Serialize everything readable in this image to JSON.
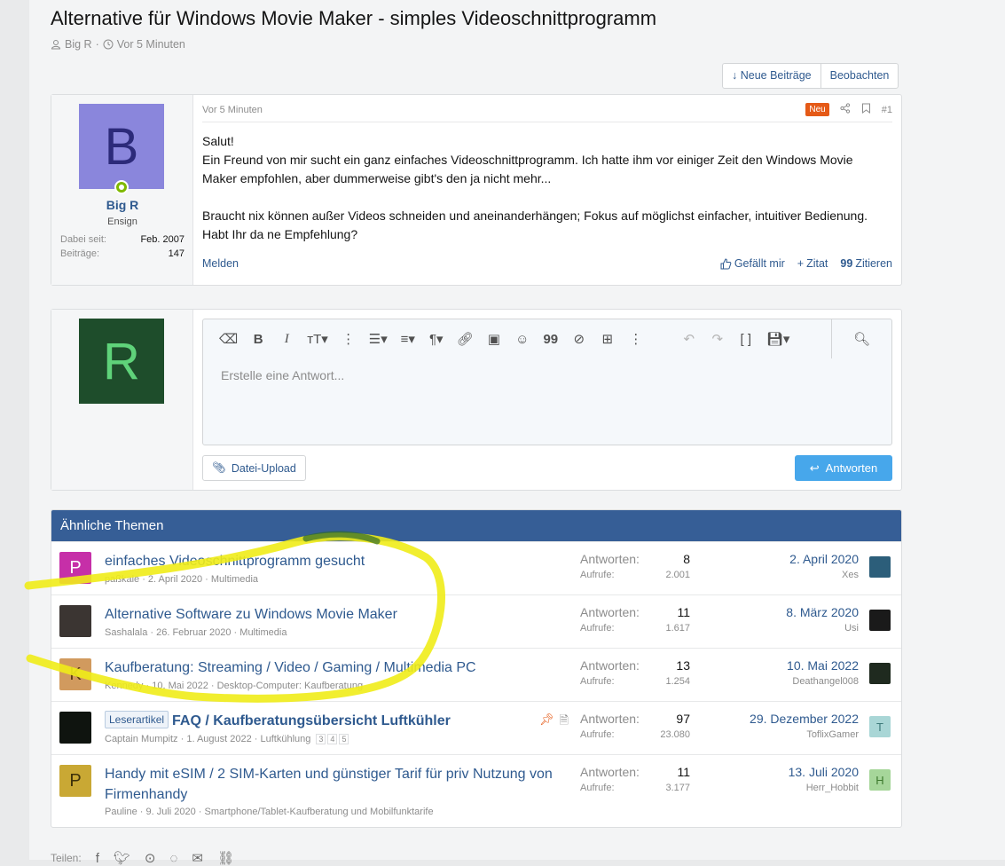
{
  "thread": {
    "title": "Alternative für Windows Movie Maker - simples Videoschnittprogramm",
    "author": "Big R",
    "time": "Vor 5 Minuten",
    "actions": [
      "↓ Neue Beiträge",
      "Beobachten"
    ]
  },
  "post": {
    "avatar_letter": "B",
    "avatar_bg": "#8a86dc",
    "avatar_fg": "#2c2a7a",
    "username": "Big R",
    "user_title": "Ensign",
    "stats": [
      {
        "label": "Dabei seit:",
        "value": "Feb. 2007"
      },
      {
        "label": "Beiträge:",
        "value": "147"
      }
    ],
    "time": "Vor 5 Minuten",
    "badge": "Neu",
    "number": "#1",
    "paragraphs": [
      "Salut!\nEin Freund von mir sucht ein ganz einfaches Videoschnittprogramm. Ich hatte ihm vor einiger Zeit den Windows Movie Maker empfohlen, aber dummerweise gibt's den ja nicht mehr...",
      "Braucht nix können außer Videos schneiden und aneinanderhängen; Fokus auf möglichst einfacher, intuitiver Bedienung. Habt Ihr da ne Empfehlung?"
    ],
    "report": "Melden",
    "like": "Gefällt mir",
    "quote_add": "Zitat",
    "quote": "Zitieren"
  },
  "reply": {
    "avatar_letter": "R",
    "avatar_bg": "#1e4d2b",
    "avatar_fg": "#5fd37a",
    "placeholder": "Erstelle eine Antwort...",
    "upload": "Datei-Upload",
    "submit": "Antworten"
  },
  "similar": {
    "heading": "Ähnliche Themen",
    "threads": [
      {
        "title": "einfaches Videoschnittprogramm gesucht",
        "author": "paßkale",
        "date": "2. April 2020",
        "forum": "Multimedia",
        "avatar": "P",
        "avatar_bg": "#c62fa8",
        "avatar_fg": "#ffffff",
        "replies_label": "Antworten:",
        "replies": "8",
        "views_label": "Aufrufe:",
        "views": "2.001",
        "last_date": "2. April 2020",
        "last_user": "Xes",
        "last_avatar": "",
        "last_bg": "#2c5e7a"
      },
      {
        "title": "Alternative Software zu Windows Movie Maker",
        "author": "Sashalala",
        "date": "26. Februar 2020",
        "forum": "Multimedia",
        "avatar": "",
        "avatar_bg": "#3b3532",
        "avatar_fg": "#ffffff",
        "replies_label": "Antworten:",
        "replies": "11",
        "views_label": "Aufrufe:",
        "views": "1.617",
        "last_date": "8. März 2020",
        "last_user": "Usi",
        "last_avatar": "",
        "last_bg": "#1a1a1a"
      },
      {
        "title": "Kaufberatung: Streaming / Video / Gaming / Multimedia PC",
        "author": "Kennedy",
        "date": "10. Mai 2022",
        "forum": "Desktop-Computer: Kaufberatung",
        "avatar": "K",
        "avatar_bg": "#d19a5e",
        "avatar_fg": "#5a3a14",
        "replies_label": "Antworten:",
        "replies": "13",
        "views_label": "Aufrufe:",
        "views": "1.254",
        "last_date": "10. Mai 2022",
        "last_user": "Deathangel008",
        "last_avatar": "",
        "last_bg": "#1f2a1f"
      },
      {
        "tag": "Leserartikel",
        "title": "FAQ / Kaufberatungsübersicht Luftkühler",
        "author": "Captain Mumpitz",
        "date": "1. August 2022",
        "forum": "Luftkühlung",
        "pages": [
          "3",
          "4",
          "5"
        ],
        "avatar": "",
        "avatar_bg": "#0f140f",
        "avatar_fg": "#5ecf5e",
        "replies_label": "Antworten:",
        "replies": "97",
        "views_label": "Aufrufe:",
        "views": "23.080",
        "last_date": "29. Dezember 2022",
        "last_user": "ToflixGamer",
        "last_avatar": "T",
        "last_bg": "#a9d6d6",
        "last_fg": "#3d7a7a"
      },
      {
        "title": "Handy mit eSIM / 2 SIM-Karten und günstiger Tarif für priv Nutzung von Firmenhandy",
        "author": "Pauline",
        "date": "9. Juli 2020",
        "forum": "Smartphone/Tablet-Kaufberatung und Mobilfunktarife",
        "avatar": "P",
        "avatar_bg": "#c9a834",
        "avatar_fg": "#3d310a",
        "replies_label": "Antworten:",
        "replies": "11",
        "views_label": "Aufrufe:",
        "views": "3.177",
        "last_date": "13. Juli 2020",
        "last_user": "Herr_Hobbit",
        "last_avatar": "H",
        "last_bg": "#a6d69a",
        "last_fg": "#3d7a2e"
      }
    ]
  },
  "share": {
    "label": "Teilen:"
  },
  "annotation_color": "#f0ec18"
}
